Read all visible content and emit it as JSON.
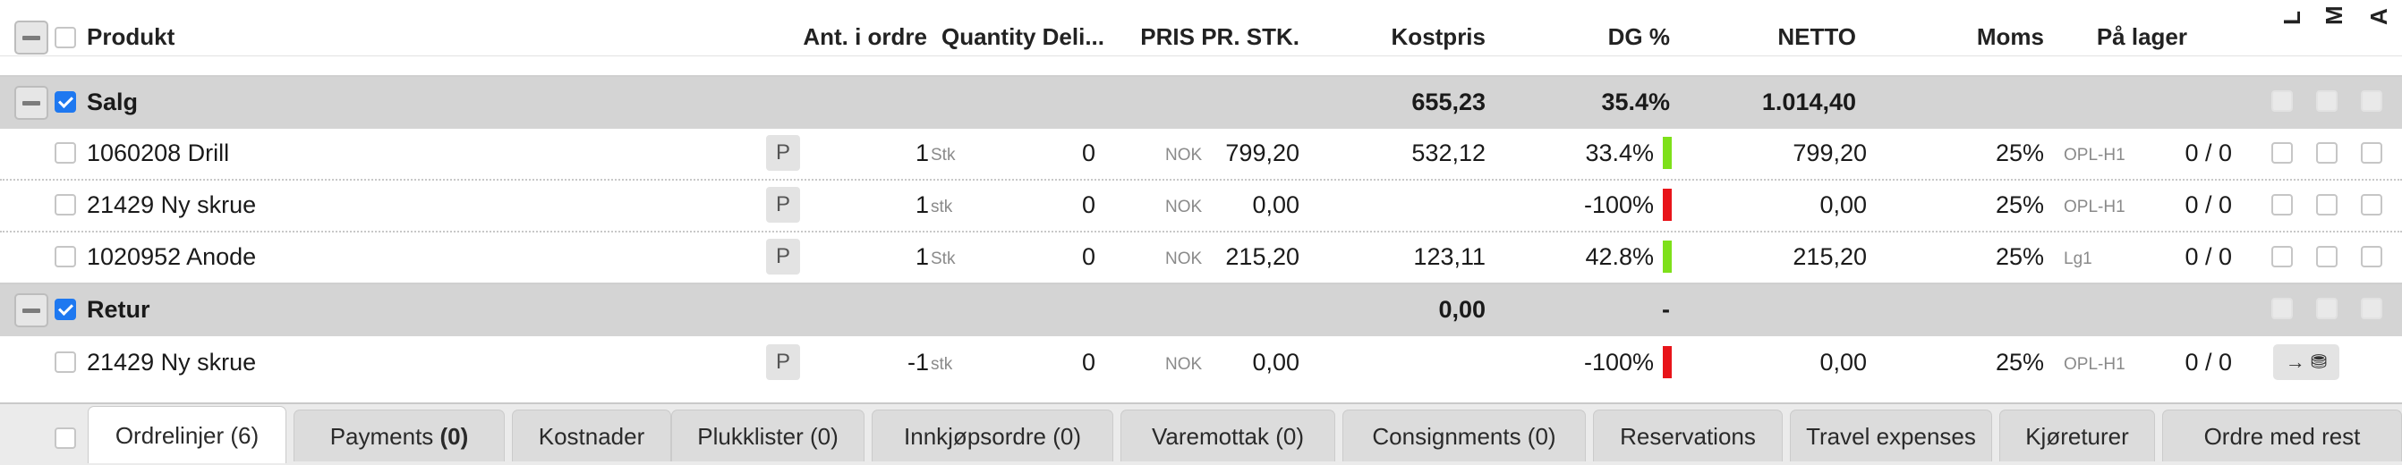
{
  "header": {
    "produkt": "Produkt",
    "ant_i_ordre": "Ant. i ordre",
    "quantity_delivered": "Quantity Deli...",
    "pris_pr_stk": "PRIS PR. STK.",
    "kostpris": "Kostpris",
    "dg": "DG %",
    "netto": "NETTO",
    "moms": "Moms",
    "pa_lager": "På lager",
    "col_l": "L",
    "col_m": "M",
    "col_a": "A"
  },
  "groups": [
    {
      "name": "Salg",
      "kostpris": "655,23",
      "dg": "35.4%",
      "netto": "1.014,40",
      "rows": [
        {
          "product": "1060208 Drill",
          "p_label": "P",
          "qty": "1",
          "unit": "Stk",
          "delivered": "0",
          "currency": "NOK",
          "price": "799,20",
          "kostpris": "532,12",
          "dg": "33.4%",
          "dg_color": "#7ee01a",
          "netto": "799,20",
          "moms": "25%",
          "location": "OPL-H1",
          "stock": "0 / 0"
        },
        {
          "product": "21429 Ny skrue",
          "p_label": "P",
          "qty": "1",
          "unit": "stk",
          "delivered": "0",
          "currency": "NOK",
          "price": "0,00",
          "kostpris": "",
          "dg": "-100%",
          "dg_color": "#e8141a",
          "netto": "0,00",
          "moms": "25%",
          "location": "OPL-H1",
          "stock": "0 / 0"
        },
        {
          "product": "1020952 Anode",
          "p_label": "P",
          "qty": "1",
          "unit": "Stk",
          "delivered": "0",
          "currency": "NOK",
          "price": "215,20",
          "kostpris": "123,11",
          "dg": "42.8%",
          "dg_color": "#7ee01a",
          "netto": "215,20",
          "moms": "25%",
          "location": "Lg1",
          "stock": "0 / 0"
        }
      ]
    },
    {
      "name": "Retur",
      "kostpris": "0,00",
      "dg": "-",
      "netto": "",
      "rows": [
        {
          "product": "21429 Ny skrue",
          "p_label": "P",
          "qty": "-1",
          "unit": "stk",
          "delivered": "0",
          "currency": "NOK",
          "price": "0,00",
          "kostpris": "",
          "dg": "-100%",
          "dg_color": "#e8141a",
          "netto": "0,00",
          "moms": "25%",
          "location": "OPL-H1",
          "stock": "0 / 0",
          "action": "→ ⛃"
        }
      ]
    }
  ],
  "tabs": [
    {
      "label": "Ordrelinjer (6)"
    },
    {
      "label": "Payments ",
      "count": "(0)"
    },
    {
      "label": "Kostnader"
    },
    {
      "label": "Plukklister (0)"
    },
    {
      "label": "Innkjøpsordre (0)"
    },
    {
      "label": "Varemottak (0)"
    },
    {
      "label": "Consignments (0)"
    },
    {
      "label": "Reservations"
    },
    {
      "label": "Travel expenses"
    },
    {
      "label": "Kjøreturer"
    },
    {
      "label": "Ordre med rest"
    }
  ],
  "colors": {
    "accent": "#1e78f0",
    "dg_good": "#7ee01a",
    "dg_bad": "#e8141a",
    "group_band": "#d4d4d4"
  }
}
